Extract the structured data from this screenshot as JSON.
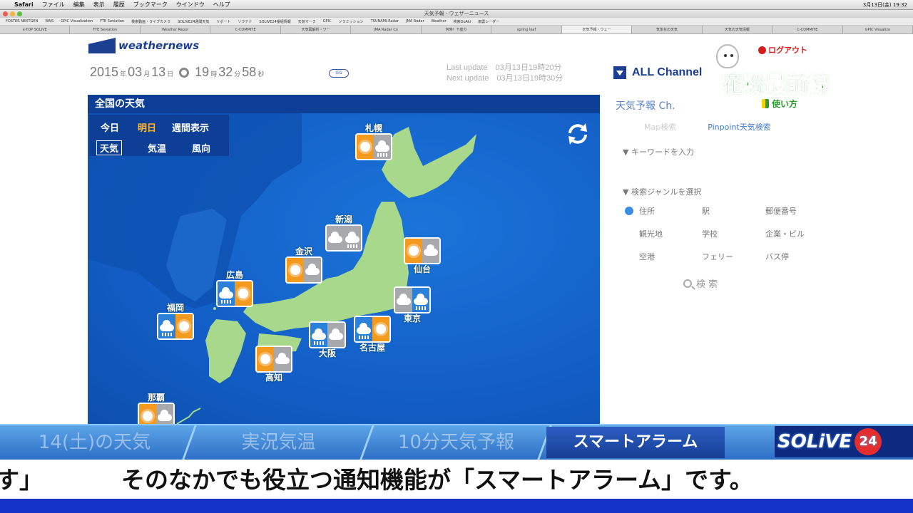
{
  "menubar": {
    "app": "Safari",
    "items": [
      "ファイル",
      "編集",
      "表示",
      "履歴",
      "ブックマーク",
      "ウインドウ",
      "ヘルプ"
    ],
    "clock": "3月13日(金) 19:32"
  },
  "window": {
    "title": "天気予報 - ウェザーニュース"
  },
  "bookmarks": [
    "FOSTER NEXTGEN",
    "WNS",
    "GPIC Visualization",
    "FTE Seviation",
    "検索動画・ライブカメラ",
    "SOLIVE24週間天気",
    "リポート",
    "ソラテナ",
    "SOLIVE24番組情報",
    "天気マーク",
    "GPIC",
    "ソラミッション",
    "TSUNAMI-Radar",
    "JMA Radar",
    "Weather",
    "検索DoAki",
    "雨雲レーダー"
  ],
  "tabs": [
    "e-TOP SOLIVE",
    "FTE Seviation",
    "Weather Repor",
    "C-COMMITE",
    "天気図解析・ワー",
    "JMA Radar Co",
    "何時！下座カ",
    "spring leaf",
    "天気予報・ウェー",
    "気象台の天気",
    "天気の天気情報",
    "C-COMMITE",
    "GPIC Visualize"
  ],
  "header": {
    "logo": "weathernews",
    "date": {
      "year": "2015",
      "year_unit": "年",
      "month": "03",
      "month_unit": "月",
      "day": "13",
      "day_unit": "日",
      "hour": "19",
      "hour_unit": "時",
      "min": "32",
      "min_unit": "分",
      "sec": "58",
      "sec_unit": "秒"
    },
    "badge": "旧1",
    "last_update": "Last update　03月13日19時20分",
    "next_update": "Next update　03月13日19時30分",
    "all_channel": "ALL Channel",
    "logout": "ログアウト",
    "pollen": "花粉最前線",
    "howto": "使い方"
  },
  "map": {
    "title": "全国の天気",
    "day_tabs": [
      "今日",
      "明日",
      "週間表示"
    ],
    "selected_day": "明日",
    "layer_tabs": [
      "天気",
      "気温",
      "風向"
    ],
    "selected_layer": "天気",
    "cities": [
      {
        "name": "札幌",
        "left": "sunny",
        "right": "snow"
      },
      {
        "name": "新潟",
        "left": "cloudy",
        "right": "snow"
      },
      {
        "name": "仙台",
        "left": "sunny",
        "right": "cloudy"
      },
      {
        "name": "金沢",
        "left": "sunny",
        "right": "cloudy"
      },
      {
        "name": "広島",
        "left": "rainy",
        "right": "sunny"
      },
      {
        "name": "福岡",
        "left": "rainy",
        "right": "sunny"
      },
      {
        "name": "東京",
        "left": "cloudy",
        "right": "rainy"
      },
      {
        "name": "大阪",
        "left": "rainy",
        "right": "cloudy"
      },
      {
        "name": "名古屋",
        "left": "rainy",
        "right": "sunny"
      },
      {
        "name": "高知",
        "left": "sunny",
        "right": "cloudy"
      },
      {
        "name": "那覇",
        "left": "sunny",
        "right": "cloudy"
      }
    ]
  },
  "side": {
    "channel": "天気予報 Ch.",
    "map_search": "Map検索",
    "pinpoint": "Pinpoint天気検索",
    "keyword": "▼ キーワードを入力",
    "genre": "▼ 検索ジャンルを選択",
    "genres": [
      "住所",
      "駅",
      "郵便番号",
      "観光地",
      "学校",
      "企業・ビル",
      "空港",
      "フェリー",
      "バス停"
    ],
    "search": "検 索"
  },
  "ticker": {
    "items": [
      "14(土)の天気",
      "実況気温",
      "10分天気予報",
      "スマートアラーム"
    ],
    "active": "スマートアラーム",
    "brand": "SOLiVE",
    "brand_num": "24"
  },
  "subtitle": {
    "prev": "す」",
    "text": "そのなかでも役立つ通知機能が「スマートアラーム」です。"
  },
  "colors": {
    "map_bg": "#125ec6",
    "land": "#a8d88c",
    "sunny": "#f39a1f",
    "rainy": "#2b80d9",
    "cloudy": "#a7a9ac",
    "ticker": "#2d6fc6",
    "bottombar": "#1633c9"
  }
}
